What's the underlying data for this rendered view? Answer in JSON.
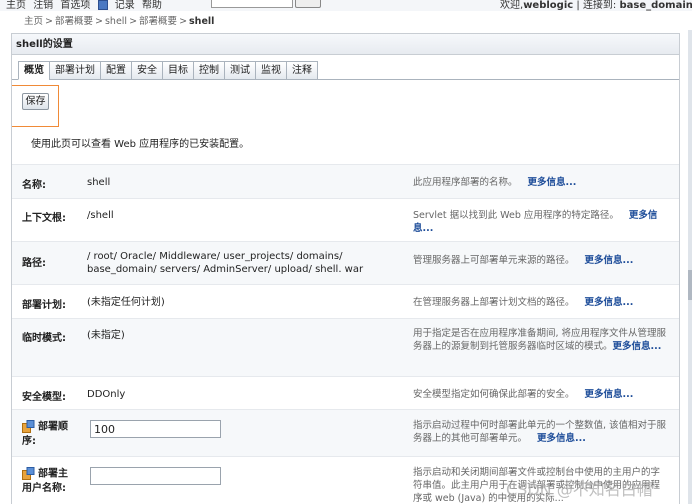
{
  "topbar": {
    "links": [
      "主页",
      "注销",
      "首选项",
      "记录",
      "帮助"
    ],
    "welcome": "欢迎,",
    "user": "weblogic",
    "connected_label": "连接到:",
    "domain": "base_domain"
  },
  "breadcrumb": {
    "items": [
      "主页",
      "部署概要",
      "shell",
      "部署概要"
    ],
    "current": "shell"
  },
  "panel": {
    "title": "shell的设置"
  },
  "tabs": [
    "概览",
    "部署计划",
    "配置",
    "安全",
    "目标",
    "控制",
    "测试",
    "监视",
    "注释"
  ],
  "save_label": "保存",
  "intro": "使用此页可以查看 Web 应用程序的已安装配置。",
  "more_info": "更多信息...",
  "rows": [
    {
      "label": "名称:",
      "value": "shell",
      "desc": "此应用程序部署的名称。"
    },
    {
      "label": "上下文根:",
      "value": "/shell",
      "desc": "Servlet 据以找到此 Web 应用程序的特定路径。"
    },
    {
      "label": "路径:",
      "value": "/ root/ Oracle/ Middleware/ user_projects/ domains/ base_domain/ servers/ AdminServer/ upload/ shell. war",
      "desc": "管理服务器上可部署单元来源的路径。"
    },
    {
      "label": "部署计划:",
      "value": "(未指定任何计划)",
      "desc": "在管理服务器上部署计划文档的路径。"
    },
    {
      "label": "临时模式:",
      "value": "(未指定)",
      "desc": "用于指定是否在应用程序准备期间, 将应用程序文件从管理服务器上的源复制到托管服务器临时区域的模式。"
    },
    {
      "label": "安全模型:",
      "value": "DDOnly",
      "desc": "安全模型指定如何确保此部署的安全。"
    },
    {
      "label": "部署顺序:",
      "value": "100",
      "desc": "指示启动过程中何时部署此单元的一个整数值, 该值相对于服务器上的其他可部署单元。"
    },
    {
      "label": "部署主用户名称:",
      "value": "",
      "desc": "指示启动和关闭期间部署文件或控制台中使用的主用户的字符串值。此主用户用于在调试部署或控制台中使用的应用程序或 web (Java) 的中使用的实际..."
    }
  ],
  "watermark": "CSDN @不知名白帽"
}
